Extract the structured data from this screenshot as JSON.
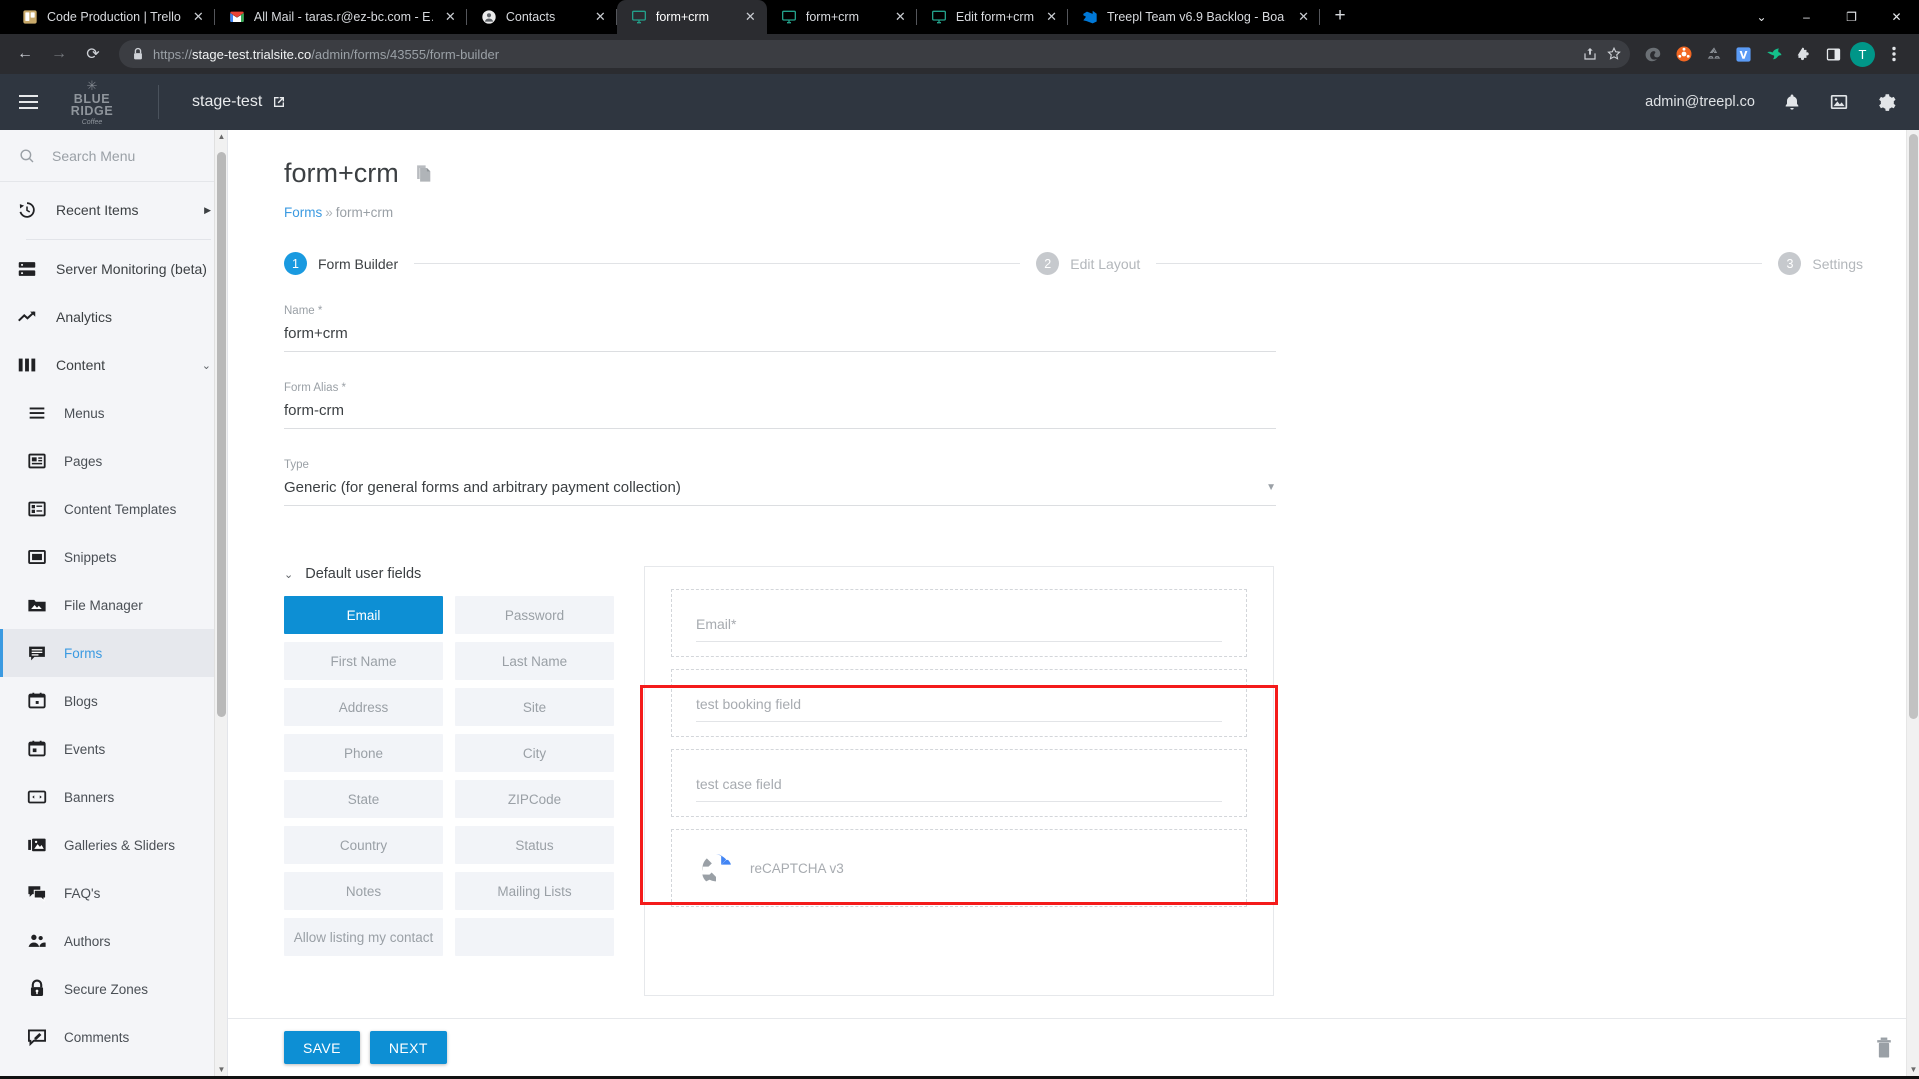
{
  "browser": {
    "tabs": [
      {
        "title": "Code Production | Trello",
        "icon": "trello-icon",
        "active": false
      },
      {
        "title": "All Mail - taras.r@ez-bc.com - E…",
        "icon": "gmail-icon",
        "active": false
      },
      {
        "title": "Contacts",
        "icon": "contacts-icon",
        "active": false
      },
      {
        "title": "form+crm",
        "icon": "monitor-icon",
        "active": true
      },
      {
        "title": "form+crm",
        "icon": "monitor-icon",
        "active": false
      },
      {
        "title": "Edit form+crm",
        "icon": "monitor-icon",
        "active": false
      },
      {
        "title": "Treepl Team v6.9 Backlog - Boa…",
        "icon": "azure-devops-icon",
        "active": false
      }
    ],
    "new_tab_label": "+",
    "window_controls": {
      "dropdown": "⌄",
      "minimize": "–",
      "maximize": "❐",
      "close": "✕"
    },
    "nav": {
      "back": "←",
      "forward": "→",
      "reload": "⟳"
    },
    "url": {
      "scheme": "https://",
      "host": "stage-test.trialsite.co",
      "path": "/admin/forms/43555/form-builder",
      "lock_icon": "lock-icon"
    },
    "omnibox_actions": [
      "share-icon",
      "bookmark-star-icon"
    ],
    "extensions": [
      "edge-copilot-icon",
      "orange-ball-icon",
      "recycle-icon",
      "v-badge-icon",
      "bird-icon",
      "puzzle-icon",
      "sidepanel-icon"
    ],
    "profile_initial": "T",
    "menu_icon": "three-dot-menu-icon"
  },
  "appbar": {
    "menu_icon": "hamburger-icon",
    "brand": {
      "snow": "✳",
      "line1": "BLUE",
      "line2": "RIDGE",
      "line3": "Coffee"
    },
    "site_name": "stage-test",
    "site_open_icon": "external-link-icon",
    "user_email": "admin@treepl.co",
    "icons": [
      "bell-icon",
      "image-icon",
      "gear-icon"
    ]
  },
  "sidebar": {
    "search_placeholder": "Search Menu",
    "search_icon": "search-icon",
    "items": [
      {
        "label": "Recent Items",
        "icon": "history-icon",
        "trailing": "chevron-right-icon",
        "level": "top"
      },
      {
        "label": "Server Monitoring (beta)",
        "icon": "server-icon",
        "level": "top"
      },
      {
        "label": "Analytics",
        "icon": "trending-up-icon",
        "level": "top"
      },
      {
        "label": "Content",
        "icon": "columns-icon",
        "trailing": "chevron-down-icon",
        "level": "top"
      },
      {
        "label": "Menus",
        "icon": "menu-lines-icon",
        "level": "sub"
      },
      {
        "label": "Pages",
        "icon": "page-icon",
        "level": "sub"
      },
      {
        "label": "Content Templates",
        "icon": "template-icon",
        "level": "sub"
      },
      {
        "label": "Snippets",
        "icon": "snippet-icon",
        "level": "sub"
      },
      {
        "label": "File Manager",
        "icon": "file-manager-icon",
        "level": "sub"
      },
      {
        "label": "Forms",
        "icon": "forms-icon",
        "level": "sub",
        "active": true
      },
      {
        "label": "Blogs",
        "icon": "blog-icon",
        "level": "sub"
      },
      {
        "label": "Events",
        "icon": "events-icon",
        "level": "sub"
      },
      {
        "label": "Banners",
        "icon": "banner-icon",
        "level": "sub"
      },
      {
        "label": "Galleries & Sliders",
        "icon": "gallery-icon",
        "level": "sub"
      },
      {
        "label": "FAQ's",
        "icon": "faq-icon",
        "level": "sub"
      },
      {
        "label": "Authors",
        "icon": "authors-icon",
        "level": "sub"
      },
      {
        "label": "Secure Zones",
        "icon": "lock-icon",
        "level": "sub"
      },
      {
        "label": "Comments",
        "icon": "comments-icon",
        "level": "sub"
      }
    ]
  },
  "page": {
    "title": "form+crm",
    "copy_icon": "copy-icon",
    "breadcrumb": {
      "root": "Forms",
      "separator": "»",
      "current": "form+crm"
    },
    "steps": [
      {
        "num": "1",
        "label": "Form Builder",
        "active": true
      },
      {
        "num": "2",
        "label": "Edit Layout",
        "active": false
      },
      {
        "num": "3",
        "label": "Settings",
        "active": false
      }
    ],
    "fields": [
      {
        "label": "Name *",
        "value": "form+crm",
        "type": "text"
      },
      {
        "label": "Form Alias *",
        "value": "form-crm",
        "type": "text"
      },
      {
        "label": "Type",
        "value": "Generic (for general forms and arbitrary payment collection)",
        "type": "select",
        "caret": "▼"
      }
    ]
  },
  "builder": {
    "pane_title": "Default user fields",
    "pane_caret": "chevron-down-icon",
    "chips": [
      {
        "label": "Email",
        "selected": true
      },
      {
        "label": "Password",
        "selected": false
      },
      {
        "label": "First Name",
        "selected": false
      },
      {
        "label": "Last Name",
        "selected": false
      },
      {
        "label": "Address",
        "selected": false
      },
      {
        "label": "Site",
        "selected": false
      },
      {
        "label": "Phone",
        "selected": false
      },
      {
        "label": "City",
        "selected": false
      },
      {
        "label": "State",
        "selected": false
      },
      {
        "label": "ZIPCode",
        "selected": false
      },
      {
        "label": "Country",
        "selected": false
      },
      {
        "label": "Status",
        "selected": false
      },
      {
        "label": "Notes",
        "selected": false
      },
      {
        "label": "Mailing Lists",
        "selected": false
      },
      {
        "label": "Allow listing my contact",
        "selected": false
      },
      {
        "label": "",
        "selected": false
      }
    ],
    "preview_fields": [
      {
        "label": "Email*",
        "kind": "input"
      },
      {
        "label": "test booking field",
        "kind": "input",
        "highlighted": true
      },
      {
        "label": "test case field",
        "kind": "input",
        "highlighted": true
      },
      {
        "label": "reCAPTCHA v3",
        "kind": "captcha",
        "icon": "recaptcha-icon"
      }
    ],
    "highlight_color": "#f41b1b"
  },
  "footer": {
    "save_label": "SAVE",
    "next_label": "NEXT",
    "delete_icon": "trash-icon"
  },
  "colors": {
    "accent": "#0d8fd4",
    "appbar": "#2f3640",
    "sidebar": "#f4f5f8",
    "link": "#3b9ae1"
  }
}
